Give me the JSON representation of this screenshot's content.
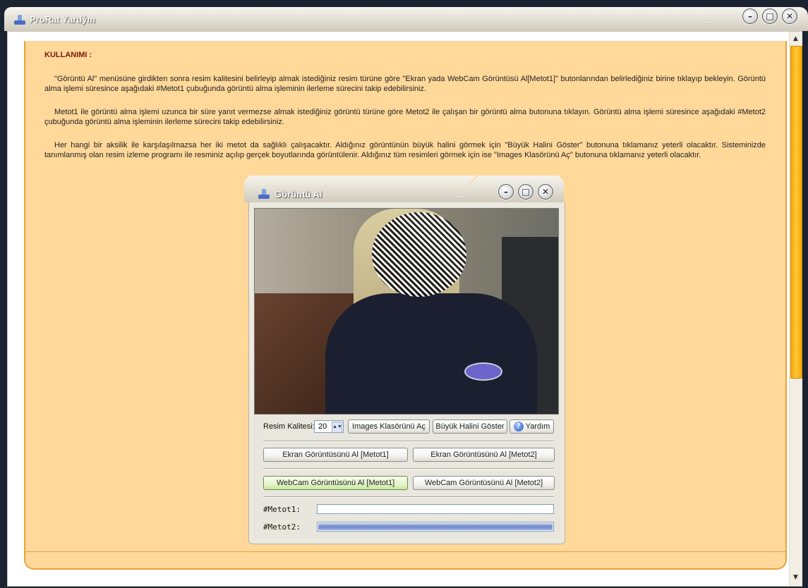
{
  "outer_window": {
    "title": "ProRat Yardým",
    "title_dots": "..."
  },
  "help": {
    "heading": "KULLANIMI :",
    "paragraphs": [
      "\"Görüntü Al\" menüsüne girdikten sonra resim kalitesini belirleyip almak istediğiniz resim türüne göre \"Ekran yada WebCam Görüntüsü Al[Metot1]\" butonlarından belirlediğiniz birine tıklayıp bekleyin. Görüntü alma işlemi süresince aşağıdaki #Metot1 çubuğunda görüntü alma işleminin ilerleme sürecini takip edebilirsiniz.",
      "Metot1 ile görüntü alma işlemi uzunca bir süre yanıt vermezse almak istediğiniz görüntü türüne göre Metot2 ile çalışan bir görüntü alma butonuna tıklayın. Görüntü alma işlemi süresince aşağıdaki #Metot2 çubuğunda görüntü alma işleminin ilerleme sürecini takip edebilirsiniz.",
      "Her hangi bir aksilik ile karşılaşılmazsa her iki metot da sağlıklı çalışacaktır.  Aldığınız görüntünün büyük halini görmek için \"Büyük Halini Göster\" butonuna tıklamanız yeterli olacaktır. Sisteminizde tanımlanmış olan resim izleme programı ile resminiz açılıp gerçek boyutlarında görüntülenir. Aldığınız tüm resimleri görmek için ise \"Images Klasörünü Aç\" butonuna tıklamanız yeterli olacaktır."
    ]
  },
  "dialog": {
    "title": "Görüntü Al",
    "title_dots": "...",
    "quality_label": "Resim Kalitesi:",
    "quality_value": "20",
    "buttons": {
      "images_folder": "Images Klasörünü Aç",
      "show_large": "Büyük Halini Göster",
      "help": "Yardım",
      "screen_m1": "Ekran Görüntüsünü Al [Metot1]",
      "screen_m2": "Ekran Görüntüsünü Al [Metot2]",
      "webcam_m1": "WebCam Görüntüsünü Al [Metot1]",
      "webcam_m2": "WebCam Görüntüsünü Al [Metot2]"
    },
    "progress": {
      "metot1_label": "#Metot1:",
      "metot1_value": 0,
      "metot2_label": "#Metot2:",
      "metot2_value": 100
    }
  },
  "window_controls": {
    "minimize": "–",
    "maximize": "□",
    "close": "✕"
  },
  "colors": {
    "help_background": "#ffd89a",
    "help_border": "#e8a23a",
    "heading_color": "#7a1a08",
    "progress_fill": "#6f87c6"
  },
  "icons": [
    "app-icon",
    "help-icon",
    "minimize-icon",
    "maximize-icon",
    "close-icon"
  ]
}
